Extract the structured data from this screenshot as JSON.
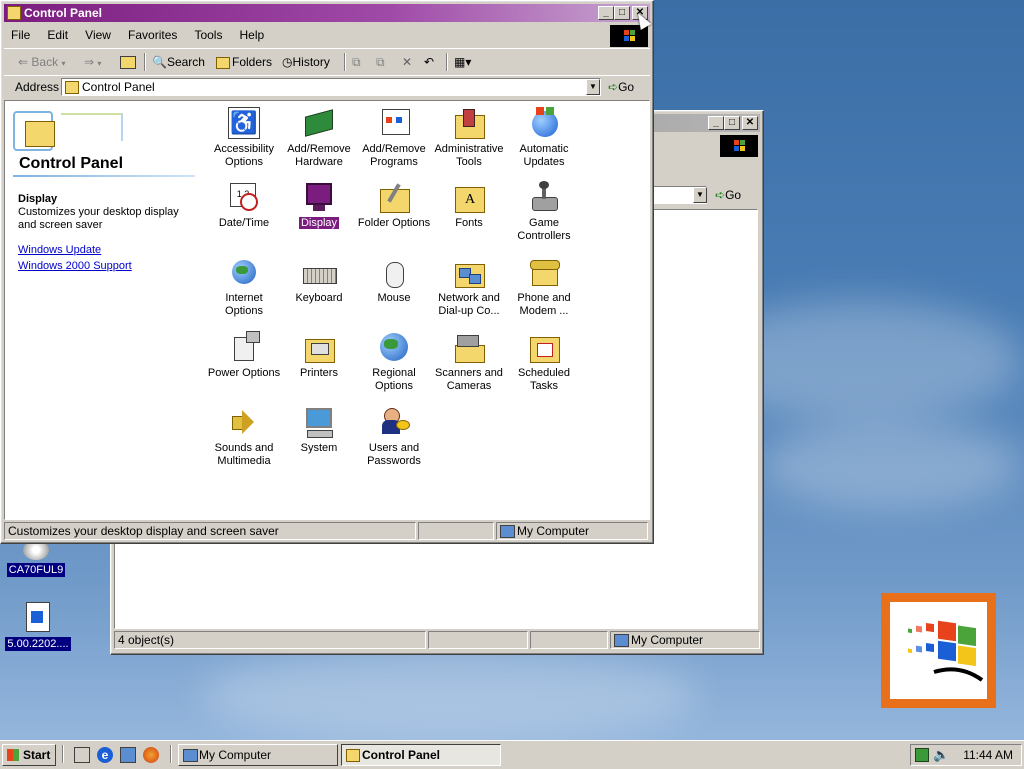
{
  "desktop": {
    "icons": [
      {
        "label": "CA70FUL9"
      },
      {
        "label": "5.00.2202...."
      }
    ]
  },
  "front_window": {
    "title": "Control Panel",
    "menu": [
      "File",
      "Edit",
      "View",
      "Favorites",
      "Tools",
      "Help"
    ],
    "toolbar": {
      "back": "Back",
      "search": "Search",
      "folders": "Folders",
      "history": "History"
    },
    "address": {
      "label": "Address",
      "value": "Control Panel",
      "go": "Go"
    },
    "left_pane": {
      "heading": "Control Panel",
      "selected_title": "Display",
      "selected_desc": "Customizes your desktop display and screen saver",
      "links": [
        "Windows Update",
        "Windows 2000 Support"
      ]
    },
    "items": [
      {
        "label": "Accessibility Options",
        "icon": "accessibility-icon"
      },
      {
        "label": "Add/Remove Hardware",
        "icon": "hardware-icon"
      },
      {
        "label": "Add/Remove Programs",
        "icon": "programs-icon"
      },
      {
        "label": "Administrative Tools",
        "icon": "admin-tools-icon"
      },
      {
        "label": "Automatic Updates",
        "icon": "windows-update-icon"
      },
      {
        "label": "Date/Time",
        "icon": "date-time-icon"
      },
      {
        "label": "Display",
        "icon": "display-icon"
      },
      {
        "label": "Folder Options",
        "icon": "folder-options-icon"
      },
      {
        "label": "Fonts",
        "icon": "fonts-icon"
      },
      {
        "label": "Game Controllers",
        "icon": "joystick-icon"
      },
      {
        "label": "Internet Options",
        "icon": "internet-icon"
      },
      {
        "label": "Keyboard",
        "icon": "keyboard-icon"
      },
      {
        "label": "Mouse",
        "icon": "mouse-icon"
      },
      {
        "label": "Network and Dial-up Co...",
        "icon": "network-icon"
      },
      {
        "label": "Phone and Modem ...",
        "icon": "phone-icon"
      },
      {
        "label": "Power Options",
        "icon": "power-icon"
      },
      {
        "label": "Printers",
        "icon": "printers-icon"
      },
      {
        "label": "Regional Options",
        "icon": "globe-icon"
      },
      {
        "label": "Scanners and Cameras",
        "icon": "scanner-icon"
      },
      {
        "label": "Scheduled Tasks",
        "icon": "scheduled-tasks-icon"
      },
      {
        "label": "Sounds and Multimedia",
        "icon": "speaker-icon"
      },
      {
        "label": "System",
        "icon": "system-icon"
      },
      {
        "label": "Users and Passwords",
        "icon": "users-icon"
      }
    ],
    "status": {
      "text": "Customizes your desktop display and screen saver",
      "zone": "My Computer"
    }
  },
  "back_window": {
    "go": "Go",
    "status": {
      "text": "4 object(s)",
      "zone": "My Computer"
    }
  },
  "taskbar": {
    "start": "Start",
    "tasks": [
      "My Computer",
      "Control Panel"
    ],
    "clock": "11:44 AM"
  },
  "colors": {
    "title_active": "#7b1d7f",
    "selection": "#7b1d7f",
    "desktop": "#3a6ea5"
  }
}
